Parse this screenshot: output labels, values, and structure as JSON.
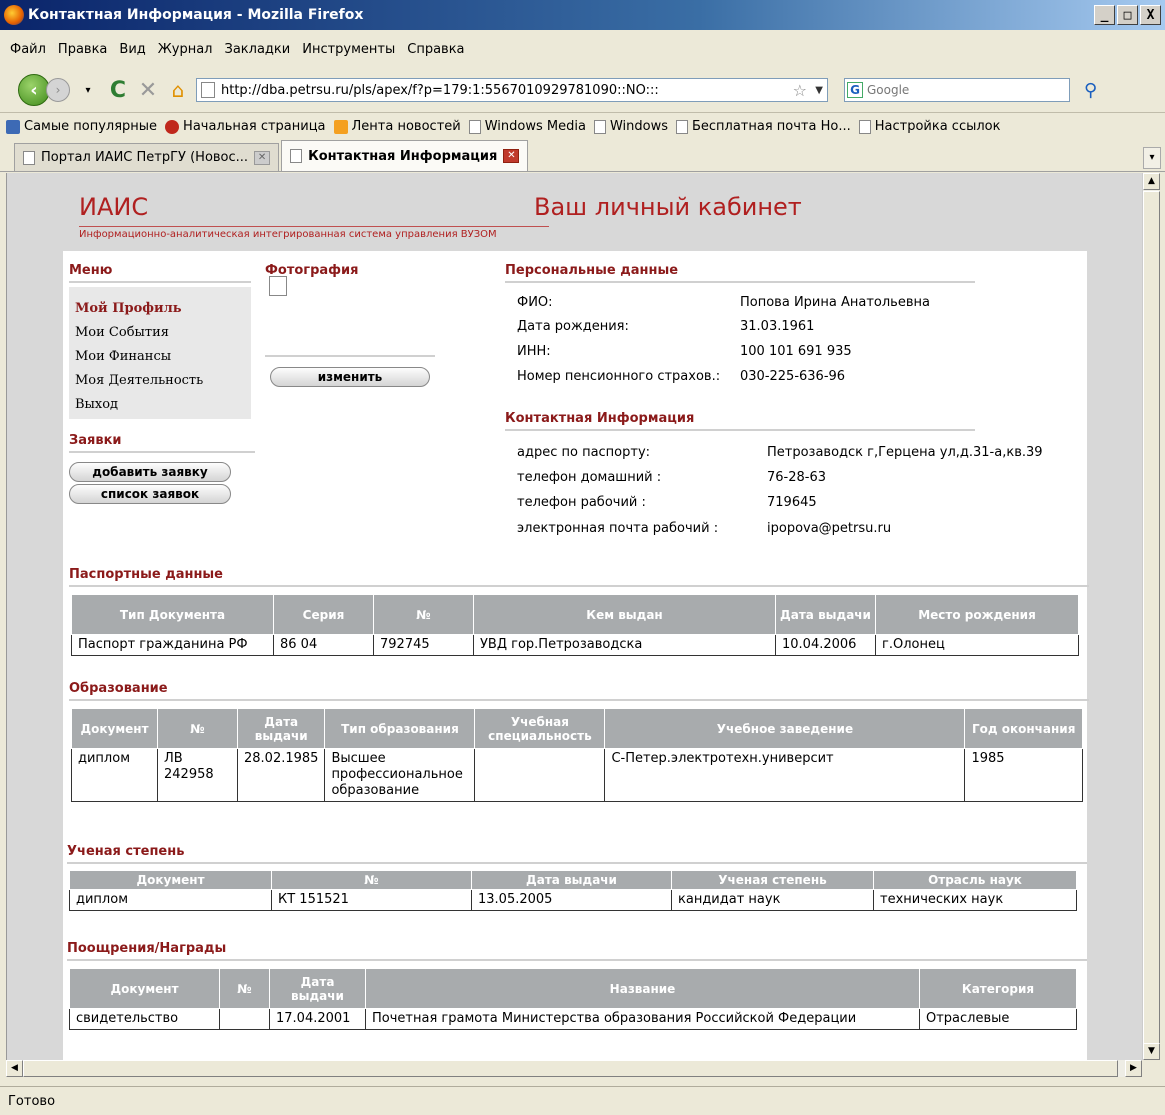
{
  "window": {
    "title": "Контактная Информация - Mozilla Firefox",
    "btn_min": "_",
    "btn_max": "□",
    "btn_close": "X"
  },
  "menu": {
    "items": [
      "Файл",
      "Правка",
      "Вид",
      "Журнал",
      "Закладки",
      "Инструменты",
      "Справка"
    ]
  },
  "nav": {
    "url": "http://dba.petrsu.ru/pls/apex/f?p=179:1:5567010929781090::NO:::",
    "search_placeholder": "Google"
  },
  "bookmarks": [
    {
      "label": "Самые популярные",
      "icon": "popular-icon"
    },
    {
      "label": "Начальная страница",
      "icon": "home-page-icon"
    },
    {
      "label": "Лента новостей",
      "icon": "rss-icon"
    },
    {
      "label": "Windows Media",
      "icon": "page-icon"
    },
    {
      "label": "Windows",
      "icon": "page-icon"
    },
    {
      "label": "Бесплатная почта Но...",
      "icon": "page-icon"
    },
    {
      "label": "Настройка ссылок",
      "icon": "page-icon"
    }
  ],
  "tabs": [
    {
      "label": "Портал ИАИС ПетрГУ (Новос...",
      "active": false
    },
    {
      "label": "Контактная Информация",
      "active": true
    }
  ],
  "status": "Готово",
  "page": {
    "logo": "ИАИС",
    "logo_sub": "Информационно-аналитическая интегрированная система управления ВУЗОМ",
    "title": "Ваш личный кабинет",
    "menu_heading": "Меню",
    "menu_items": [
      "Мой Профиль",
      "Мои События",
      "Мои Финансы",
      "Моя Деятельность",
      "Выход"
    ],
    "requests_heading": "Заявки",
    "add_request": "добавить заявку",
    "request_list": "список заявок",
    "photo_heading": "Фотография",
    "change_button": "изменить",
    "personal_heading": "Персональные данные",
    "personal": [
      {
        "label": "ФИО:",
        "value": "Попова Ирина Анатольевна"
      },
      {
        "label": "Дата рождения:",
        "value": "31.03.1961"
      },
      {
        "label": "ИНН:",
        "value": "100 101 691 935"
      },
      {
        "label": "Номер пенсионного страхов.:",
        "value": "030-225-636-96"
      }
    ],
    "contact_heading": "Контактная Информация",
    "contact": [
      {
        "label": "адрес по паспорту:",
        "value": "Петрозаводск г,Герцена ул,д.31-а,кв.39"
      },
      {
        "label": "телефон домашний :",
        "value": "76-28-63"
      },
      {
        "label": "телефон рабочий :",
        "value": "719645"
      },
      {
        "label": "электронная почта рабочий :",
        "value": "ipopova@petrsu.ru"
      }
    ],
    "passport_heading": "Паспортные данные",
    "passport_cols": [
      "Тип Документа",
      "Серия",
      "№",
      "Кем выдан",
      "Дата выдачи",
      "Место рождения"
    ],
    "passport_rows": [
      [
        "Паспорт гражданина РФ",
        "86 04",
        "792745",
        "УВД гор.Петрозаводска",
        "10.04.2006",
        "г.Олонец"
      ]
    ],
    "edu_heading": "Образование",
    "edu_cols": [
      "Документ",
      "№",
      "Дата выдачи",
      "Тип образования",
      "Учебная специальность",
      "Учебное заведение",
      "Год окончания"
    ],
    "edu_rows": [
      [
        "диплом",
        "ЛВ 242958",
        "28.02.1985",
        "Высшее профессиональное образование",
        "",
        "С-Петер.электротехн.университ",
        "1985"
      ]
    ],
    "degree_heading": "Ученая степень",
    "degree_cols": [
      "Документ",
      "№",
      "Дата выдачи",
      "Ученая степень",
      "Отрасль наук"
    ],
    "degree_rows": [
      [
        "диплом",
        "КТ 151521",
        "13.05.2005",
        "кандидат наук",
        "технических наук"
      ]
    ],
    "awards_heading": "Поощрения/Награды",
    "awards_cols": [
      "Документ",
      "№",
      "Дата выдачи",
      "Название",
      "Категория"
    ],
    "awards_rows": [
      [
        "свидетельство",
        "",
        "17.04.2001",
        "Почетная грамота Министерства образования Российской Федерации",
        "Отраслевые"
      ]
    ]
  }
}
